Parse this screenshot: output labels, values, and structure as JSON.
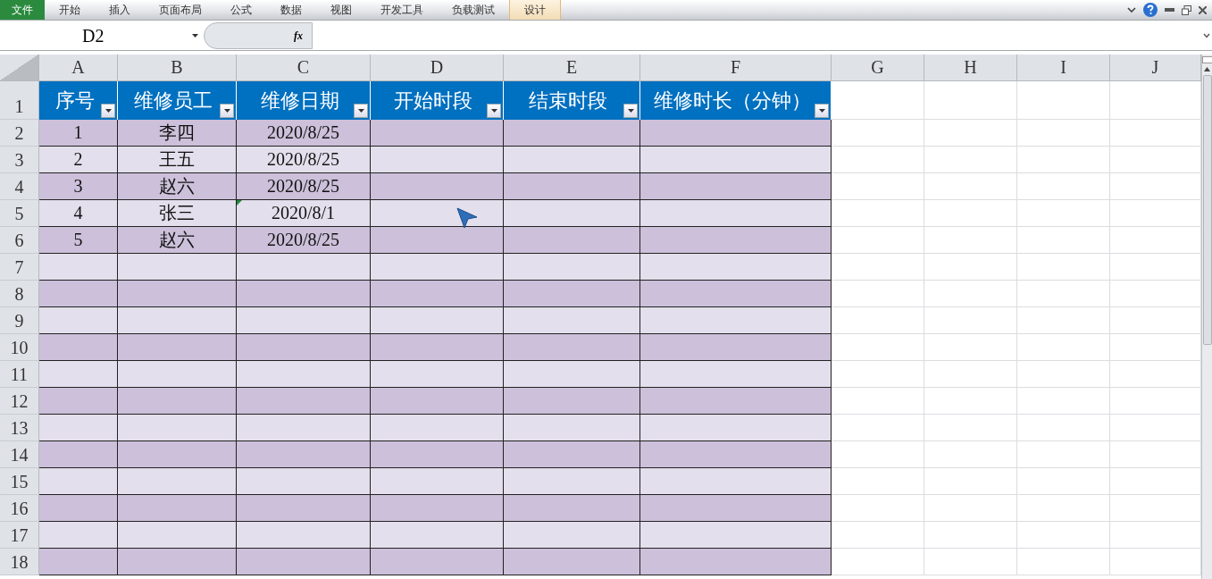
{
  "ribbon_tabs": [
    {
      "label": "文件",
      "kind": "file"
    },
    {
      "label": "开始",
      "kind": "normal"
    },
    {
      "label": "插入",
      "kind": "normal"
    },
    {
      "label": "页面布局",
      "kind": "normal"
    },
    {
      "label": "公式",
      "kind": "normal"
    },
    {
      "label": "数据",
      "kind": "normal"
    },
    {
      "label": "视图",
      "kind": "normal"
    },
    {
      "label": "开发工具",
      "kind": "normal"
    },
    {
      "label": "负载测试",
      "kind": "normal"
    },
    {
      "label": "设计",
      "kind": "contextual"
    }
  ],
  "formula_bar": {
    "name_box": "D2",
    "fx_label": "fx"
  },
  "column_headers": [
    "A",
    "B",
    "C",
    "D",
    "E",
    "F",
    "G",
    "H",
    "I",
    "J"
  ],
  "row_headers": [
    "1",
    "2",
    "3",
    "4",
    "5",
    "6",
    "7",
    "8",
    "9",
    "10",
    "11",
    "12",
    "13",
    "14",
    "15",
    "16",
    "17",
    "18"
  ],
  "table": {
    "columns": [
      "序号",
      "维修员工",
      "维修日期",
      "开始时段",
      "结束时段",
      "维修时长（分钟）"
    ],
    "rows": [
      {
        "cells": [
          "1",
          "李四",
          "2020/8/25"
        ],
        "date_flagged": false
      },
      {
        "cells": [
          "2",
          "王五",
          "2020/8/25"
        ],
        "date_flagged": false
      },
      {
        "cells": [
          "3",
          "赵六",
          "2020/8/25"
        ],
        "date_flagged": false
      },
      {
        "cells": [
          "4",
          "张三",
          "2020/8/1"
        ],
        "date_flagged": true
      },
      {
        "cells": [
          "5",
          "赵六",
          "2020/8/25"
        ],
        "date_flagged": false
      }
    ]
  }
}
